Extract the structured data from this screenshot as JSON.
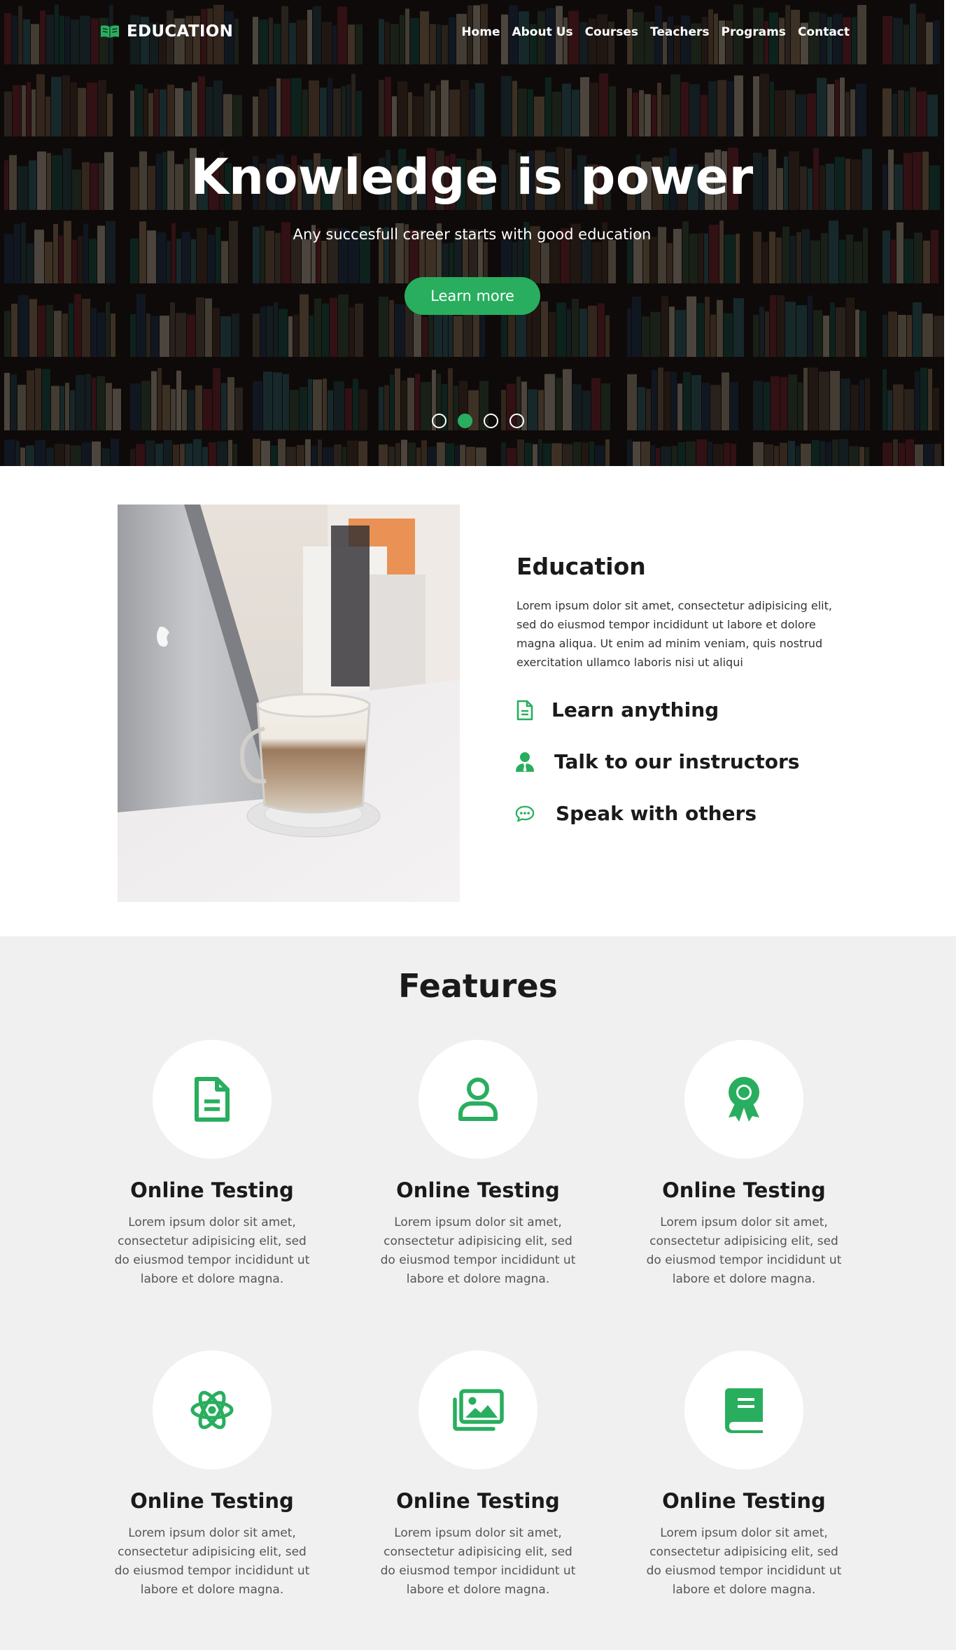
{
  "brand": {
    "name": "EDUCATION",
    "icon": "open-book-icon",
    "accent": "#28ae5e"
  },
  "nav": {
    "items": [
      "Home",
      "About Us",
      "Courses",
      "Teachers",
      "Programs",
      "Contact"
    ]
  },
  "hero": {
    "title": "Knowledge is power",
    "subtitle": "Any succesfull career starts with good education",
    "button": "Learn more",
    "slides": 4,
    "active_slide": 2
  },
  "about": {
    "title": "Education",
    "text": "Lorem ipsum dolor sit amet, consectetur adipisicing elit, sed do eiusmod tempor incididunt ut labore et dolore magna aliqua. Ut enim ad minim veniam, quis nostrud exercitation ullamco laboris nisi ut aliqui",
    "items": [
      {
        "icon": "document-icon",
        "label": "Learn anything"
      },
      {
        "icon": "instructor-icon",
        "label": "Talk to our instructors"
      },
      {
        "icon": "chat-icon",
        "label": "Speak with others"
      }
    ]
  },
  "features": {
    "title": "Features",
    "cards": [
      {
        "icon": "document-icon",
        "title": "Online Testing",
        "text": "Lorem ipsum dolor sit amet, consectetur adipisicing elit, sed do eiusmod tempor incididunt ut labore et dolore magna."
      },
      {
        "icon": "user-icon",
        "title": "Online Testing",
        "text": "Lorem ipsum dolor sit amet, consectetur adipisicing elit, sed do eiusmod tempor incididunt ut labore et dolore magna."
      },
      {
        "icon": "award-icon",
        "title": "Online Testing",
        "text": "Lorem ipsum dolor sit amet, consectetur adipisicing elit, sed do eiusmod tempor incididunt ut labore et dolore magna."
      },
      {
        "icon": "atom-icon",
        "title": "Online Testing",
        "text": "Lorem ipsum dolor sit amet, consectetur adipisicing elit, sed do eiusmod tempor incididunt ut labore et dolore magna."
      },
      {
        "icon": "gallery-icon",
        "title": "Online Testing",
        "text": "Lorem ipsum dolor sit amet, consectetur adipisicing elit, sed do eiusmod tempor incididunt ut labore et dolore magna."
      },
      {
        "icon": "book-icon",
        "title": "Online Testing",
        "text": "Lorem ipsum dolor sit amet, consectetur adipisicing elit, sed do eiusmod tempor incididunt ut labore et dolore magna."
      }
    ]
  }
}
